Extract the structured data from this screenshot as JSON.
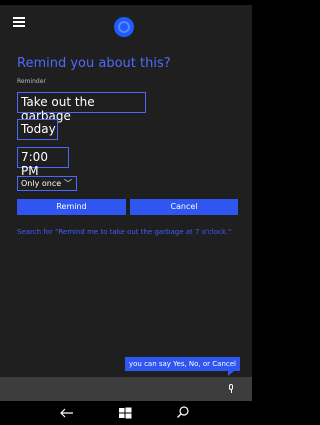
{
  "dialog": {
    "title": "Remind you about this?",
    "reminder_label": "Reminder",
    "reminder_text": "Take out the garbage",
    "date": "Today",
    "time": "7:00 PM",
    "repeat": "Only once",
    "remind_button": "Remind",
    "cancel_button": "Cancel",
    "search_link": "Search for \"Remind me to take out the garbage at 7 o'clock.\""
  },
  "hint_bubble": "you can say Yes, No, or Cancel",
  "colors": {
    "accent": "#2f56f0",
    "link": "#3e5dff",
    "background": "#1f1f1f"
  },
  "icons": {
    "menu": "hamburger-menu-icon",
    "cortana": "cortana-icon",
    "chevron": "chevron-down-icon",
    "mic": "microphone-icon",
    "back": "back-arrow-icon",
    "start": "windows-start-icon",
    "search": "search-icon"
  }
}
